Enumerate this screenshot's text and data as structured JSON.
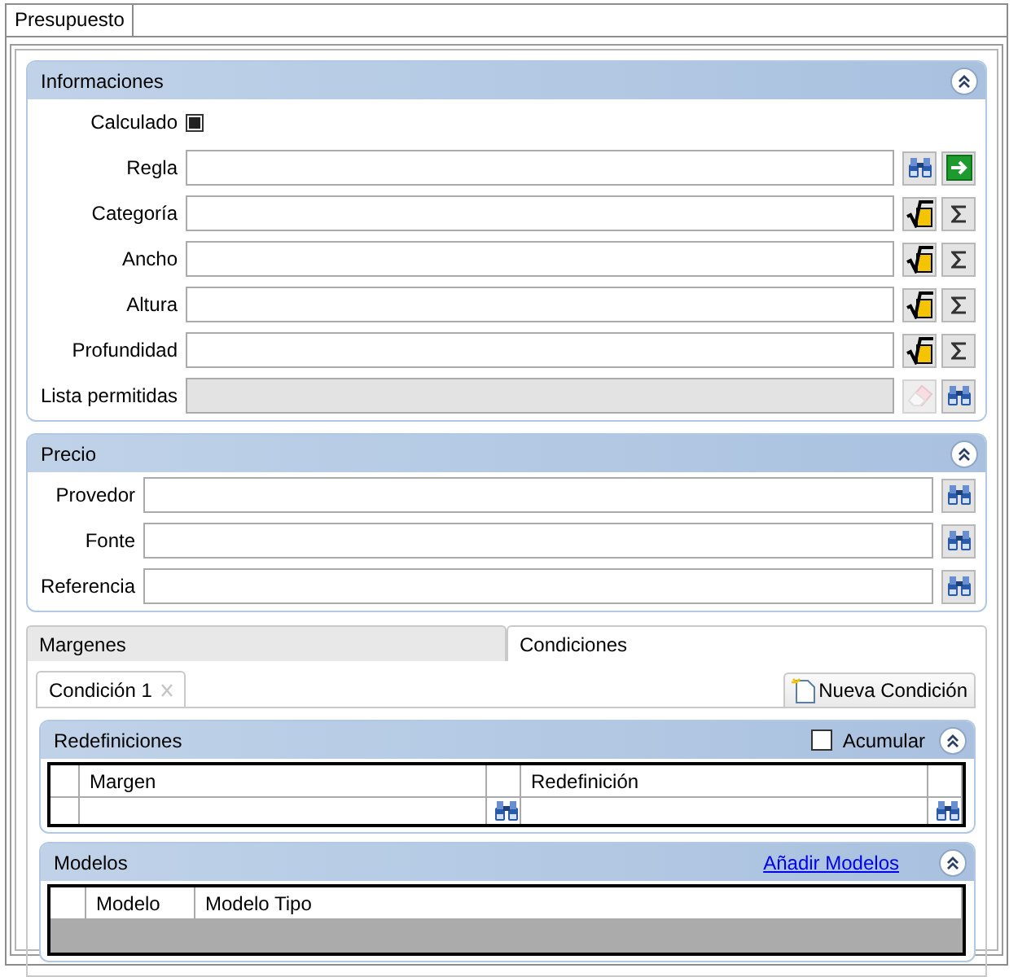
{
  "tabs": [
    {
      "label": "Presupuesto",
      "selected": true
    }
  ],
  "informaciones": {
    "title": "Informaciones",
    "fields": [
      {
        "label": "Calculado",
        "kind": "checkbox",
        "checked": true
      },
      {
        "label": "Regla",
        "kind": "text",
        "disabled": false,
        "buttons": [
          {
            "kind": "search"
          },
          {
            "kind": "go"
          }
        ]
      },
      {
        "label": "Categoría",
        "kind": "text",
        "disabled": false,
        "buttons": [
          {
            "kind": "formula"
          },
          {
            "kind": "sum"
          }
        ]
      },
      {
        "label": "Ancho",
        "kind": "text",
        "disabled": false,
        "buttons": [
          {
            "kind": "formula"
          },
          {
            "kind": "sum"
          }
        ]
      },
      {
        "label": "Altura",
        "kind": "text",
        "disabled": false,
        "buttons": [
          {
            "kind": "formula"
          },
          {
            "kind": "sum"
          }
        ]
      },
      {
        "label": "Profundidad",
        "kind": "text",
        "disabled": false,
        "buttons": [
          {
            "kind": "formula"
          },
          {
            "kind": "sum"
          }
        ]
      },
      {
        "label": "Lista permitidas",
        "kind": "text",
        "disabled": true,
        "buttons": [
          {
            "kind": "erase"
          },
          {
            "kind": "search"
          }
        ]
      }
    ]
  },
  "precio": {
    "title": "Precio",
    "fields": [
      {
        "label": "Provedor",
        "kind": "text",
        "disabled": false,
        "buttons": [
          {
            "kind": "search"
          }
        ]
      },
      {
        "label": "Fonte",
        "kind": "text",
        "disabled": false,
        "buttons": [
          {
            "kind": "search"
          }
        ]
      },
      {
        "label": "Referencia",
        "kind": "text",
        "disabled": false,
        "buttons": [
          {
            "kind": "search"
          }
        ]
      }
    ]
  },
  "detail_tabs": [
    {
      "label": "Margenes",
      "selected": false
    },
    {
      "label": "Condiciones",
      "selected": true
    }
  ],
  "condition_tabs": [
    {
      "label": "Condición 1",
      "selected": true
    }
  ],
  "new_condition_button": "Nueva Condición",
  "redefiniciones": {
    "title": "Redefiniciones",
    "acumular": {
      "label": "Acumular",
      "checked": false
    },
    "table": {
      "columns": [
        "Margen",
        "Redefinición"
      ]
    }
  },
  "modelos": {
    "title": "Modelos",
    "link": "Añadir Modelos",
    "table": {
      "columns": [
        "Modelo",
        "Modelo Tipo"
      ]
    }
  }
}
